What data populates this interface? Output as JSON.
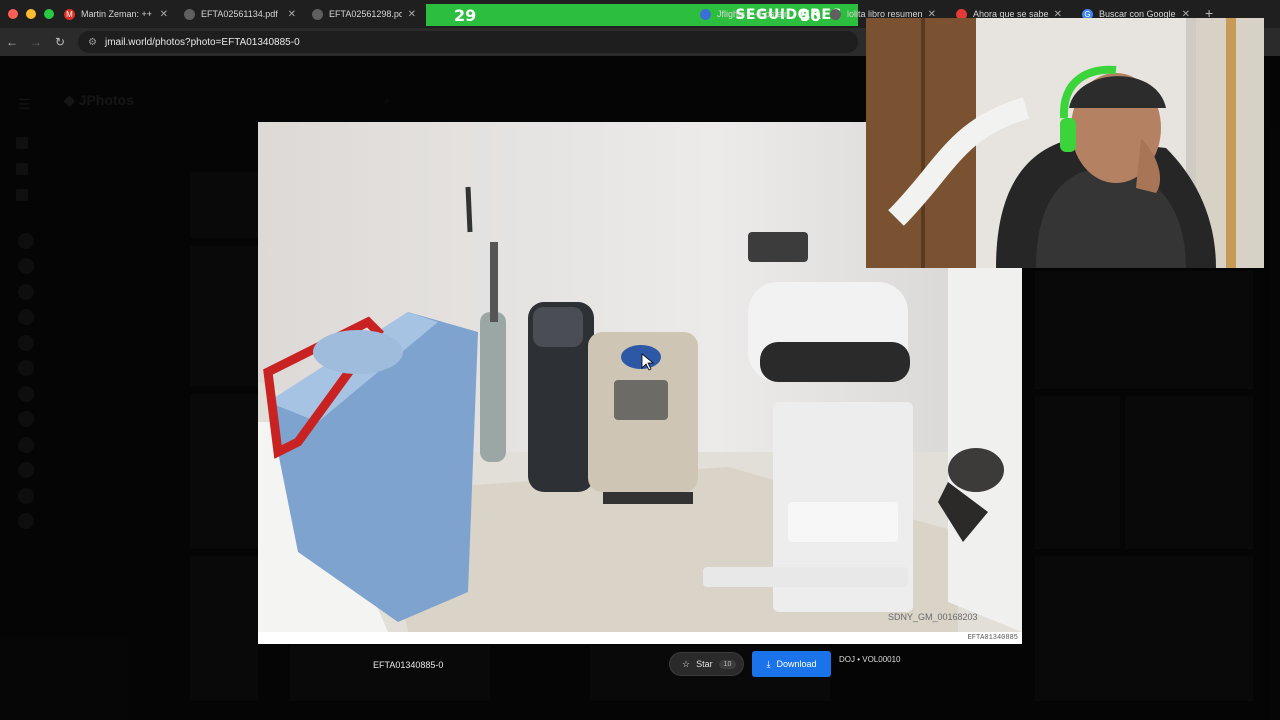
{
  "browser": {
    "tabs": [
      {
        "title": "Martin Zeman: ++ Ot",
        "favicon": "gmail-icon",
        "color": "#d93025"
      },
      {
        "title": "EFTA02561134.pdf",
        "favicon": "globe-icon",
        "color": "#777777"
      },
      {
        "title": "EFTA02561298.pdf",
        "favicon": "globe-icon",
        "color": "#777777"
      },
      {
        "title": "Jflights — Epstein Fli",
        "favicon": "plane-icon",
        "color": "#3b6fd8"
      },
      {
        "title": "lolita libro resumen -",
        "favicon": "globe-icon",
        "color": "#777777"
      },
      {
        "title": "Ahora que se sabe la",
        "favicon": "youtube-icon",
        "color": "#e53935"
      },
      {
        "title": "Buscar con Google",
        "favicon": "google-icon",
        "color": "#4285f4"
      }
    ],
    "url": "jmail.world/photos?photo=EFTA01340885-0"
  },
  "stream_overlay": {
    "follower_count": "29",
    "follower_label": "SEGUIDORES",
    "goal": "50"
  },
  "viewer": {
    "file_name": "EFTA01340885-0",
    "star_label": "Star",
    "star_count": "10",
    "download_label": "Download",
    "volume": "DOJ • VOL00010",
    "photo_stamp": "SDNY_GM_00168203",
    "photo_caption": "EFTA01340885"
  },
  "colors": {
    "download_button": "#1a73e8",
    "follower_banner": "#2cbf3f"
  }
}
